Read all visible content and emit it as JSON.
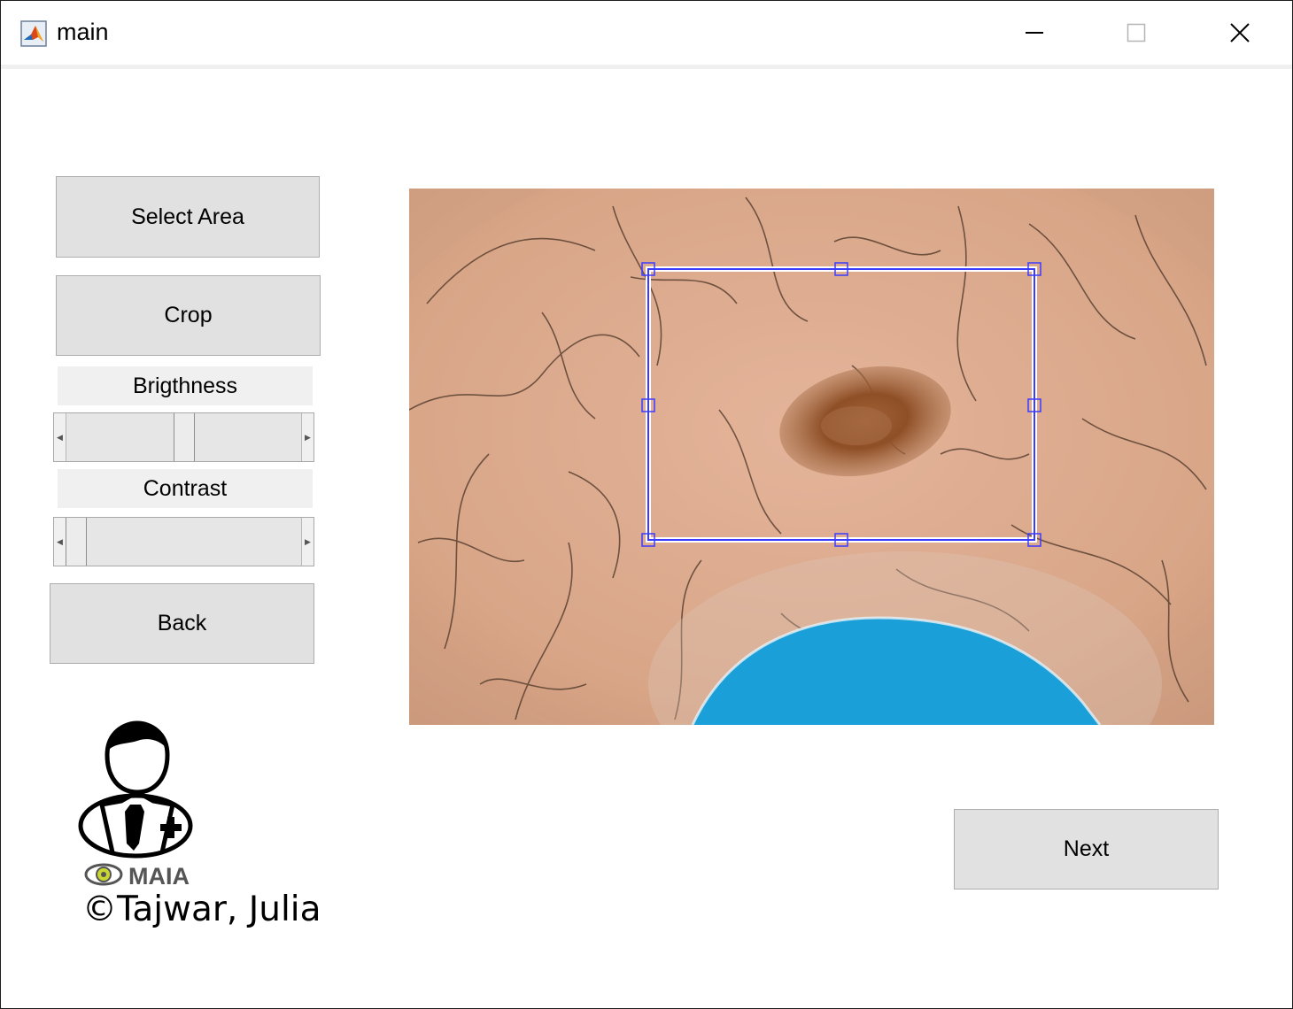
{
  "window": {
    "title": "main",
    "controls": {
      "minimize": "minimize",
      "maximize": "maximize",
      "close": "close"
    }
  },
  "buttons": {
    "select_area": "Select Area",
    "crop": "Crop",
    "back": "Back",
    "next": "Next"
  },
  "brightness": {
    "label": "Brigthness",
    "value": 0.5
  },
  "contrast": {
    "label": "Contrast",
    "value": 0.0
  },
  "logo": {
    "brand_text": "MAIA"
  },
  "credit": "©Tajwar, Julia",
  "colors": {
    "button_face": "#e1e1e1",
    "selection": "#3b3bff",
    "skin": "#d9a88c",
    "lesion": "#8c4a22",
    "patch": "#1a9fd8"
  }
}
